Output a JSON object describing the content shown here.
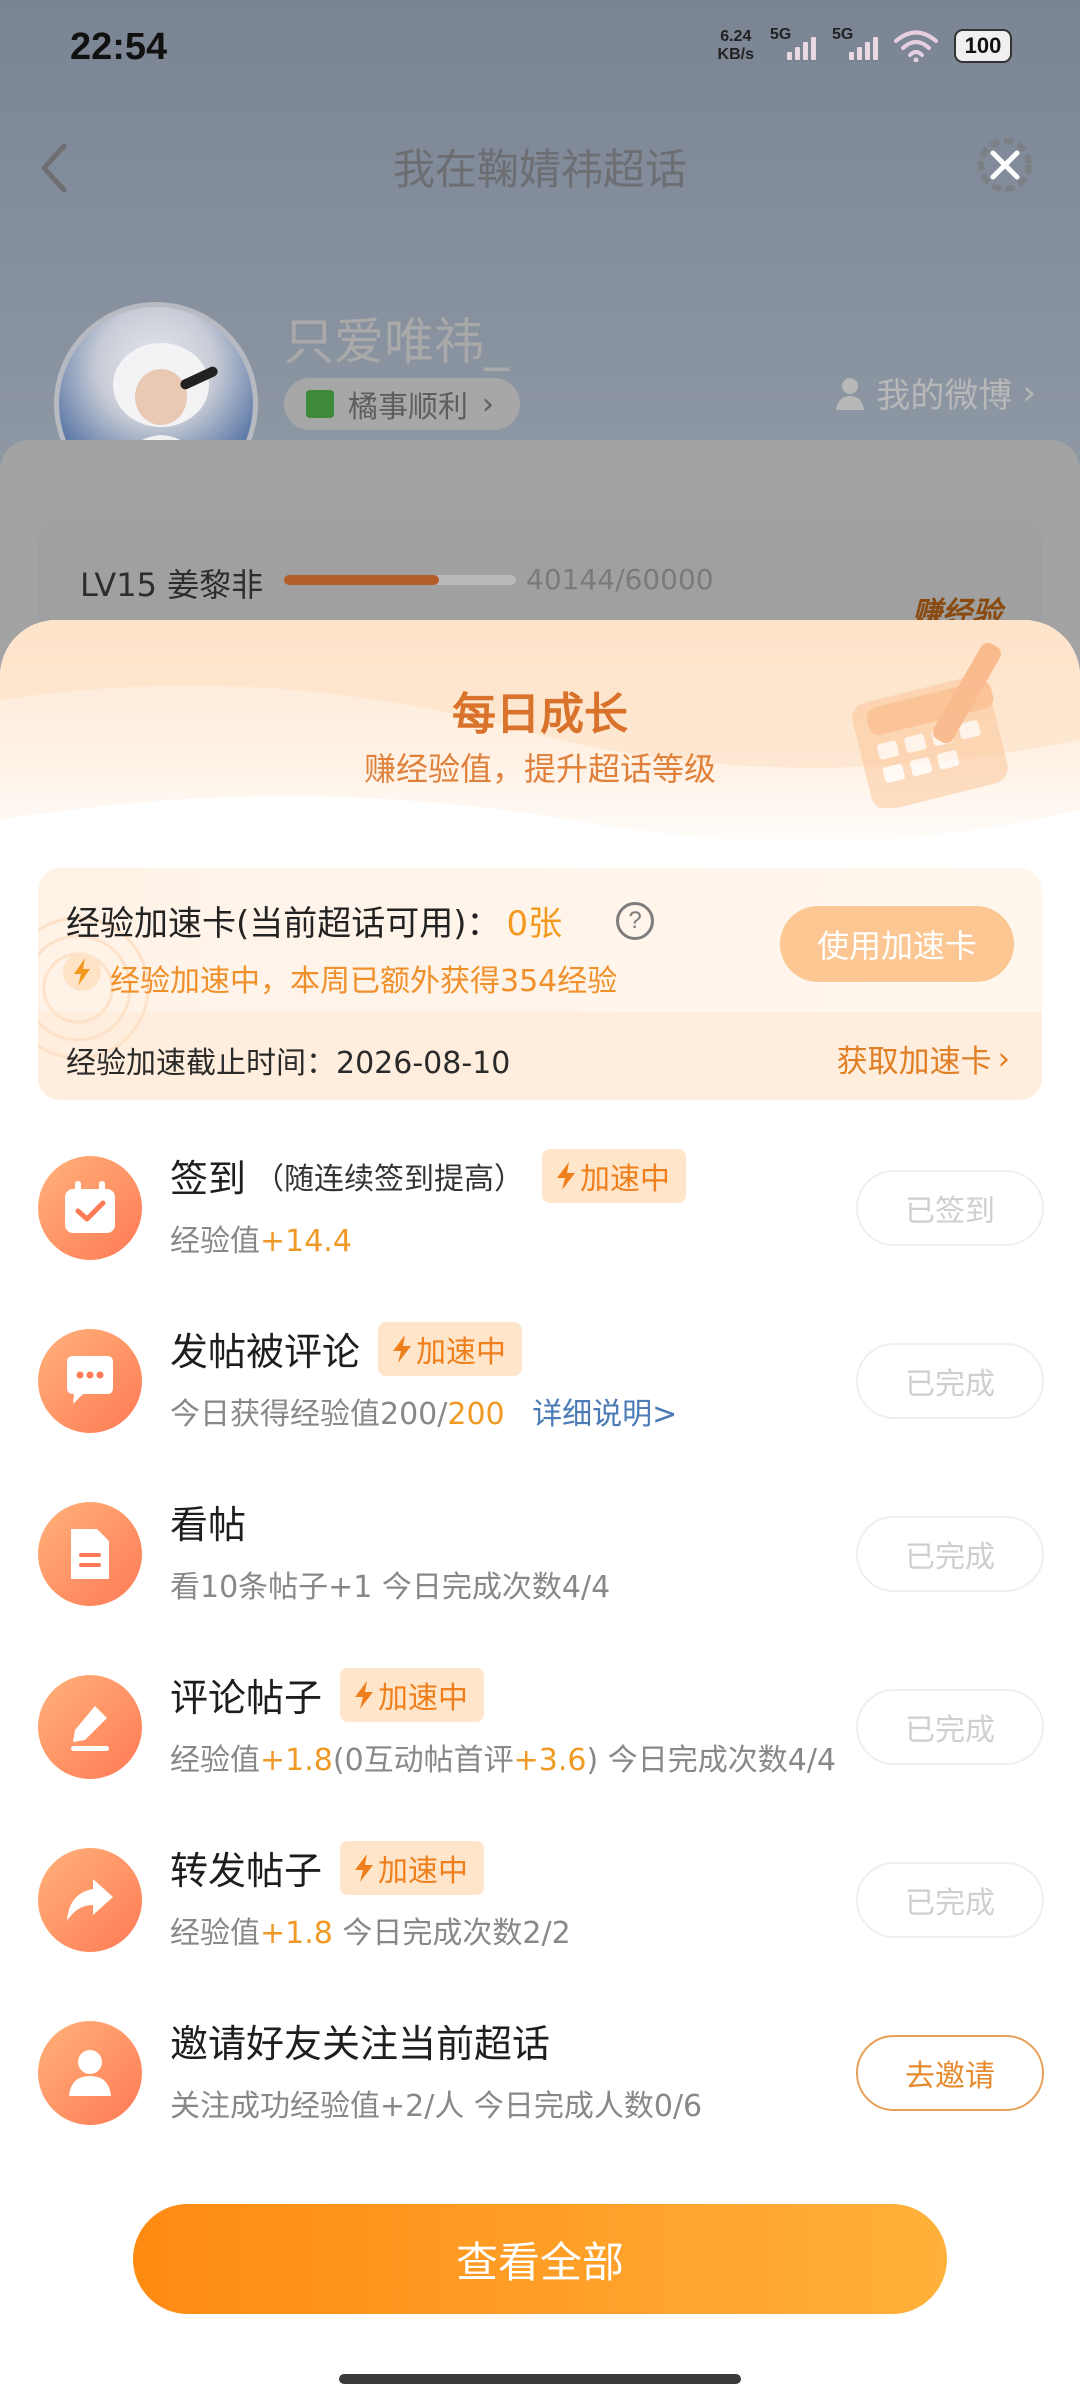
{
  "status_bar": {
    "time": "22:54",
    "net_speed_value": "6.24",
    "net_speed_unit": "KB/s",
    "sim1_label": "5G",
    "sim2_label": "5G",
    "battery": "100"
  },
  "nav": {
    "title": "我在鞠婧祎超话",
    "back_icon": "chevron-left-icon",
    "settings_icon": "gear-icon",
    "close_icon": "close-icon"
  },
  "profile": {
    "username": "只爱唯祎_",
    "medal": "橘事顺利",
    "my_weibo": "我的微博"
  },
  "level": {
    "label": "LV15 姜黎非",
    "progress_text": "40144/60000",
    "progress_fraction": 0.669,
    "earn_badge": "赚经验"
  },
  "sheet": {
    "title": "每日成长",
    "subtitle": "赚经验值，提升超话等级"
  },
  "boost_card": {
    "title": "经验加速卡(当前超话可用)：",
    "count": "0张",
    "status": "经验加速中，本周已额外获得354经验",
    "use_button": "使用加速卡",
    "deadline": "经验加速截止时间：2026-08-10",
    "get_link": "获取加速卡"
  },
  "badge_label": "加速中",
  "tasks": [
    {
      "title": "签到",
      "note": "（随连续签到提高）",
      "desc_pre": "经验值",
      "desc_hi": "+14.4",
      "button": "已签到"
    },
    {
      "title": "发帖被评论",
      "desc_pre": "今日获得经验值200/",
      "desc_hi": "200",
      "desc_link": "详细说明>",
      "button": "已完成"
    },
    {
      "title": "看帖",
      "desc_pre": "看10条帖子+1   今日完成次数4/4",
      "button": "已完成"
    },
    {
      "title": "评论帖子",
      "desc_pre": "经验值",
      "desc_hi": "+1.8",
      "desc_mid": "(0互动帖首评",
      "desc_hi2": "+3.6",
      "desc_post": ")   今日完成次数4/4",
      "button": "已完成"
    },
    {
      "title": "转发帖子",
      "desc_pre": "经验值",
      "desc_hi": "+1.8",
      "desc_post": "   今日完成次数2/2",
      "button": "已完成"
    },
    {
      "title": "邀请好友关注当前超话",
      "desc_pre": "关注成功经验值+2/人   今日完成人数0/6",
      "button": "去邀请"
    }
  ],
  "view_all": "查看全部",
  "colors": {
    "accent": "#f39a1e",
    "title_orange": "#d9722a",
    "icon_gradient_start": "#ffb27a",
    "icon_gradient_end": "#ff7a55",
    "cta_start": "#ff8a12",
    "cta_end": "#ffb13a"
  }
}
